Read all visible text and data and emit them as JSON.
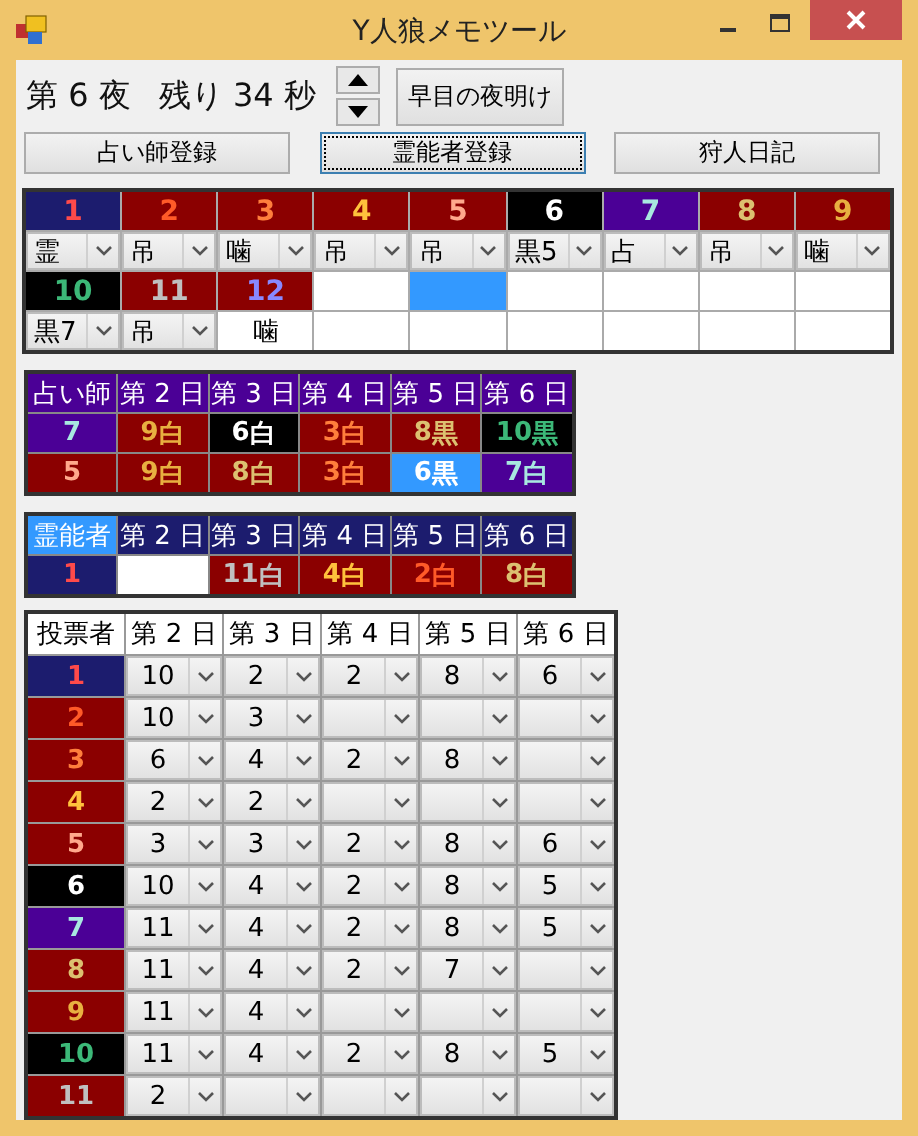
{
  "window": {
    "title": "Y人狼メモツール"
  },
  "status": {
    "night": "第 6 夜",
    "remaining": "残り 34 秒"
  },
  "dawn_button": "早目の夜明け",
  "register_buttons": [
    {
      "label": "占い師登録",
      "focused": false
    },
    {
      "label": "霊能者登録",
      "focused": true
    },
    {
      "label": "狩人日記",
      "focused": false
    }
  ],
  "grid": {
    "cells": [
      {
        "kind": "player",
        "color": "#1c1c6e",
        "number": {
          "text": "1",
          "color": "#ff4a4a"
        },
        "status": {
          "text": "霊",
          "kind": "dropdown"
        }
      },
      {
        "kind": "player",
        "color": "#8b0000",
        "number": {
          "text": "2",
          "color": "#ff5a28"
        },
        "status": {
          "text": "吊",
          "kind": "dropdown"
        }
      },
      {
        "kind": "player",
        "color": "#8b0000",
        "number": {
          "text": "3",
          "color": "#ff7e3c"
        },
        "status": {
          "text": "噛",
          "kind": "dropdown"
        }
      },
      {
        "kind": "player",
        "color": "#8b0000",
        "number": {
          "text": "4",
          "color": "#ffc23c"
        },
        "status": {
          "text": "吊",
          "kind": "dropdown"
        }
      },
      {
        "kind": "player",
        "color": "#8b0000",
        "number": {
          "text": "5",
          "color": "#ffa88c"
        },
        "status": {
          "text": "吊",
          "kind": "dropdown"
        }
      },
      {
        "kind": "player",
        "color": "#000000",
        "number": {
          "text": "6",
          "color": "#ffffff"
        },
        "status": {
          "text": "黒5",
          "kind": "dropdown"
        }
      },
      {
        "kind": "player",
        "color": "#4b0096",
        "number": {
          "text": "7",
          "color": "#a8e8e0"
        },
        "status": {
          "text": "占",
          "kind": "dropdown"
        }
      },
      {
        "kind": "player",
        "color": "#8b0000",
        "number": {
          "text": "8",
          "color": "#dcc070"
        },
        "status": {
          "text": "吊",
          "kind": "dropdown"
        }
      },
      {
        "kind": "player",
        "color": "#8b0000",
        "number": {
          "text": "9",
          "color": "#e8b040"
        },
        "status": {
          "text": "噛",
          "kind": "dropdown"
        }
      },
      {
        "kind": "player",
        "color": "#000000",
        "number": {
          "text": "10",
          "color": "#3cb878"
        },
        "status": {
          "text": "黒7",
          "kind": "dropdown"
        }
      },
      {
        "kind": "player",
        "color": "#8b0000",
        "number": {
          "text": "11",
          "color": "#c0c0c0"
        },
        "status": {
          "text": "吊",
          "kind": "dropdown"
        }
      },
      {
        "kind": "player",
        "color": "#8b0000",
        "number": {
          "text": "12",
          "color": "#8888ff"
        },
        "status": {
          "text": "噛",
          "kind": "text"
        }
      },
      {
        "kind": "empty",
        "selected": false
      },
      {
        "kind": "empty",
        "selected": true
      },
      {
        "kind": "empty",
        "selected": false
      },
      {
        "kind": "empty",
        "selected": false
      },
      {
        "kind": "empty",
        "selected": false
      },
      {
        "kind": "empty",
        "selected": false
      }
    ]
  },
  "seer_table": {
    "corner": {
      "text": "占い師",
      "color": "#4b0096"
    },
    "header": {
      "color": "#4b0096",
      "days": [
        "第 2 日",
        "第 3 日",
        "第 4 日",
        "第 5 日",
        "第 6 日"
      ]
    },
    "rows": [
      {
        "cells": [
          {
            "kind": "result",
            "color": "#4b0096",
            "target": {
              "text": "7",
              "color": "#a8e8e0"
            }
          },
          {
            "kind": "result",
            "color": "#8b0000",
            "target": {
              "text": "9",
              "color": "#e8b040"
            },
            "verdict": "白"
          },
          {
            "kind": "result",
            "color": "#000000",
            "target": {
              "text": "6",
              "color": "#ffffff"
            },
            "verdict": "白"
          },
          {
            "kind": "result",
            "color": "#8b0000",
            "target": {
              "text": "3",
              "color": "#ff7e3c"
            },
            "verdict": "白"
          },
          {
            "kind": "result",
            "color": "#8b0000",
            "target": {
              "text": "8",
              "color": "#dcc070"
            },
            "verdict": "黒"
          },
          {
            "kind": "result",
            "color": "#000000",
            "target": {
              "text": "10",
              "color": "#3cb878"
            },
            "verdict": "黒"
          }
        ]
      },
      {
        "cells": [
          {
            "kind": "result",
            "color": "#8b0000",
            "target": {
              "text": "5",
              "color": "#ffa88c"
            }
          },
          {
            "kind": "result",
            "color": "#8b0000",
            "target": {
              "text": "9",
              "color": "#e8b040"
            },
            "verdict": "白"
          },
          {
            "kind": "result",
            "color": "#8b0000",
            "target": {
              "text": "8",
              "color": "#dcc070"
            },
            "verdict": "白"
          },
          {
            "kind": "result",
            "color": "#8b0000",
            "target": {
              "text": "3",
              "color": "#ff7e3c"
            },
            "verdict": "白"
          },
          {
            "kind": "result",
            "color": "#3399ff",
            "target": {
              "text": "6",
              "color": "#ffffff"
            },
            "verdict": "黒"
          },
          {
            "kind": "result",
            "color": "#4b0096",
            "target": {
              "text": "7",
              "color": "#a8e8e0"
            },
            "verdict": "白"
          }
        ]
      }
    ]
  },
  "medium_table": {
    "corner": {
      "text": "霊能者",
      "color": "#3399ff"
    },
    "header": {
      "color": "#1c1c6e",
      "days": [
        "第 2 日",
        "第 3 日",
        "第 4 日",
        "第 5 日",
        "第 6 日"
      ]
    },
    "rows": [
      {
        "cells": [
          {
            "kind": "result",
            "color": "#1c1c6e",
            "target": {
              "text": "1",
              "color": "#ff4a4a"
            }
          },
          {
            "kind": "empty"
          },
          {
            "kind": "result",
            "color": "#8b0000",
            "target": {
              "text": "11",
              "color": "#c0c0c0"
            },
            "verdict": "白"
          },
          {
            "kind": "result",
            "color": "#8b0000",
            "target": {
              "text": "4",
              "color": "#ffc23c"
            },
            "verdict": "白"
          },
          {
            "kind": "result",
            "color": "#8b0000",
            "target": {
              "text": "2",
              "color": "#ff5a28"
            },
            "verdict": "白"
          },
          {
            "kind": "result",
            "color": "#8b0000",
            "target": {
              "text": "8",
              "color": "#dcc070"
            },
            "verdict": "白"
          }
        ]
      }
    ]
  },
  "vote_table": {
    "corner": "投票者",
    "days": [
      "第 2 日",
      "第 3 日",
      "第 4 日",
      "第 5 日",
      "第 6 日"
    ],
    "rows": [
      {
        "color": "#1c1c6e",
        "voter": {
          "text": "1",
          "color": "#ff4a4a"
        },
        "votes": [
          {
            "value": "10"
          },
          {
            "value": "2"
          },
          {
            "value": "2"
          },
          {
            "value": "8"
          },
          {
            "value": "6"
          }
        ]
      },
      {
        "color": "#8b0000",
        "voter": {
          "text": "2",
          "color": "#ff5a28"
        },
        "votes": [
          {
            "value": "10"
          },
          {
            "value": "3"
          },
          {
            "empty": true
          },
          {
            "empty": true
          },
          {
            "empty": true
          }
        ]
      },
      {
        "color": "#8b0000",
        "voter": {
          "text": "3",
          "color": "#ff7e3c"
        },
        "votes": [
          {
            "value": "6"
          },
          {
            "value": "4"
          },
          {
            "value": "2"
          },
          {
            "value": "8"
          },
          {
            "empty": true
          }
        ]
      },
      {
        "color": "#8b0000",
        "voter": {
          "text": "4",
          "color": "#ffc23c"
        },
        "votes": [
          {
            "value": "2"
          },
          {
            "value": "2"
          },
          {
            "empty": true
          },
          {
            "empty": true
          },
          {
            "empty": true
          }
        ]
      },
      {
        "color": "#8b0000",
        "voter": {
          "text": "5",
          "color": "#ffa88c"
        },
        "votes": [
          {
            "value": "3"
          },
          {
            "value": "3"
          },
          {
            "value": "2"
          },
          {
            "value": "8"
          },
          {
            "value": "6"
          }
        ]
      },
      {
        "color": "#000000",
        "voter": {
          "text": "6",
          "color": "#ffffff"
        },
        "votes": [
          {
            "value": "10"
          },
          {
            "value": "4"
          },
          {
            "value": "2"
          },
          {
            "value": "8"
          },
          {
            "value": "5"
          }
        ]
      },
      {
        "color": "#4b0096",
        "voter": {
          "text": "7",
          "color": "#a8e8e0"
        },
        "votes": [
          {
            "value": "11"
          },
          {
            "value": "4"
          },
          {
            "value": "2"
          },
          {
            "value": "8"
          },
          {
            "value": "5"
          }
        ]
      },
      {
        "color": "#8b0000",
        "voter": {
          "text": "8",
          "color": "#dcc070"
        },
        "votes": [
          {
            "value": "11"
          },
          {
            "value": "4"
          },
          {
            "value": "2"
          },
          {
            "value": "7"
          },
          {
            "empty": true
          }
        ]
      },
      {
        "color": "#8b0000",
        "voter": {
          "text": "9",
          "color": "#e8b040"
        },
        "votes": [
          {
            "value": "11"
          },
          {
            "value": "4"
          },
          {
            "empty": true
          },
          {
            "empty": true
          },
          {
            "empty": true
          }
        ]
      },
      {
        "color": "#000000",
        "voter": {
          "text": "10",
          "color": "#3cb878"
        },
        "votes": [
          {
            "value": "11"
          },
          {
            "value": "4"
          },
          {
            "value": "2"
          },
          {
            "value": "8"
          },
          {
            "value": "5"
          }
        ]
      },
      {
        "color": "#8b0000",
        "voter": {
          "text": "11",
          "color": "#c0c0c0"
        },
        "votes": [
          {
            "value": "2"
          },
          {
            "empty": true
          },
          {
            "empty": true
          },
          {
            "empty": true
          },
          {
            "empty": true
          }
        ]
      }
    ]
  }
}
